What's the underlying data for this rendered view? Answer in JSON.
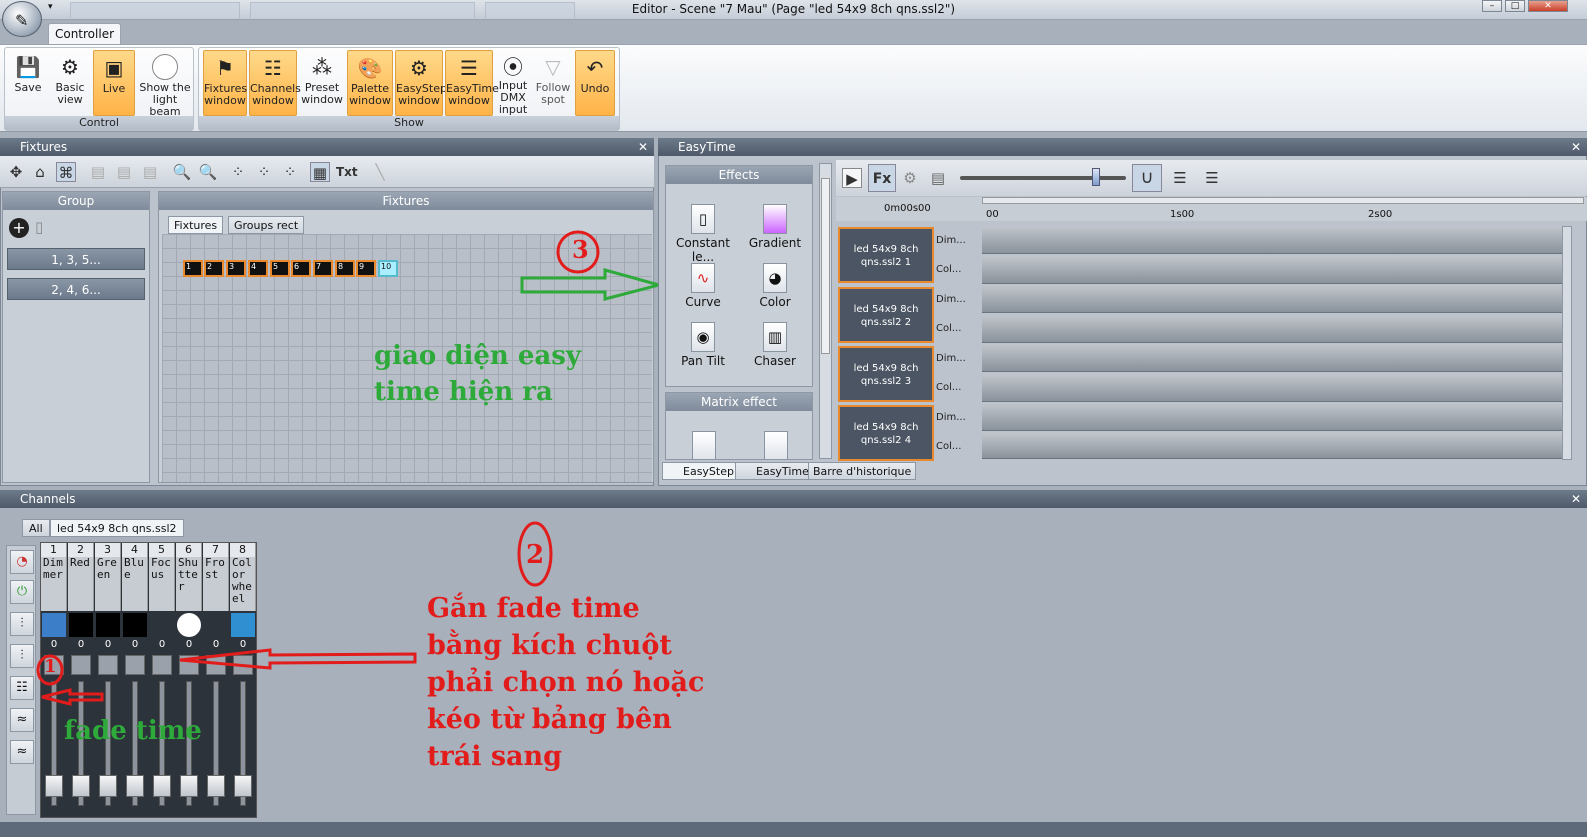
{
  "window": {
    "title": "Editor - Scene \"7 Mau\" (Page \"led 54x9 8ch qns.ssl2\")",
    "bg_tabs": [
      "",
      "",
      ""
    ]
  },
  "ribbon": {
    "tab": "Controller",
    "groups": {
      "control": "Control",
      "show": "Show"
    },
    "buttons": {
      "save": "Save",
      "basic_view_1": "Basic",
      "basic_view_2": "view",
      "live": "Live",
      "light_beam_1": "Show the",
      "light_beam_2": "light beam",
      "fixtures_1": "Fixtures",
      "fixtures_2": "window",
      "channels_1": "Channels",
      "channels_2": "window",
      "preset_1": "Preset",
      "preset_2": "window",
      "palette_1": "Palette",
      "palette_2": "window",
      "easystep_1": "EasyStep",
      "easystep_2": "window",
      "easytime_1": "EasyTime",
      "easytime_2": "window",
      "dmx_1": "Input",
      "dmx_2": "DMX",
      "dmx_3": "input",
      "follow_1": "Follow",
      "follow_2": "spot",
      "undo": "Undo"
    }
  },
  "fixtures_panel": {
    "title": "Fixtures",
    "txt_button": "Txt",
    "group_header": "Group",
    "groups": [
      "1, 3, 5...",
      "2, 4, 6..."
    ],
    "fixtures_header": "Fixtures",
    "tabs": [
      "Fixtures",
      "Groups rect"
    ],
    "fixture_numbers": [
      "1",
      "2",
      "3",
      "4",
      "5",
      "6",
      "7",
      "8",
      "9",
      "10"
    ]
  },
  "easytime_panel": {
    "title": "EasyTime",
    "effects_header": "Effects",
    "effects": [
      "Constant le...",
      "Gradient",
      "Curve",
      "Color",
      "Pan Tilt",
      "Chaser"
    ],
    "matrix_header": "Matrix effect",
    "time_display": "0m00s00",
    "ruler": [
      "00",
      "1s00",
      "2s00"
    ],
    "tracks": [
      {
        "l1": "led 54x9 8ch",
        "l2": "qns.ssl2  1"
      },
      {
        "l1": "led 54x9 8ch",
        "l2": "qns.ssl2  2"
      },
      {
        "l1": "led 54x9 8ch",
        "l2": "qns.ssl2  3"
      },
      {
        "l1": "led 54x9 8ch",
        "l2": "qns.ssl2  4"
      }
    ],
    "chan_labels": [
      "Dim...",
      "Col..."
    ],
    "bottom_tabs": [
      "EasyStep",
      "EasyTime",
      "Barre d'historique"
    ]
  },
  "channels_panel": {
    "title": "Channels",
    "tabs": [
      "All",
      "led 54x9 8ch qns.ssl2"
    ],
    "channels": [
      {
        "num": "1",
        "name": "Dimmer",
        "value": "0",
        "color": "#3d7ec9"
      },
      {
        "num": "2",
        "name": "Red",
        "value": "0",
        "color": "#000000"
      },
      {
        "num": "3",
        "name": "Green",
        "value": "0",
        "color": "#000000"
      },
      {
        "num": "4",
        "name": "Blue",
        "value": "0",
        "color": "#000000"
      },
      {
        "num": "5",
        "name": "Focus",
        "value": "0",
        "color": "#2d333b"
      },
      {
        "num": "6",
        "name": "Shutter",
        "value": "0",
        "color": "#ffffff"
      },
      {
        "num": "7",
        "name": "Frost",
        "value": "0",
        "color": "#2d333b"
      },
      {
        "num": "8",
        "name": "Color wheel",
        "value": "0",
        "color": "#2f8fd0"
      }
    ]
  },
  "annotations": {
    "n1": "1",
    "n2": "2",
    "n3": "3",
    "text_green_1": "giao diện easy",
    "text_green_2": "time hiện ra",
    "text_red": [
      "Gắn fade time",
      "bằng kích chuột",
      "phải chọn nó hoặc",
      "kéo từ bảng bên",
      "trái sang"
    ],
    "fade_time": "fade time"
  }
}
